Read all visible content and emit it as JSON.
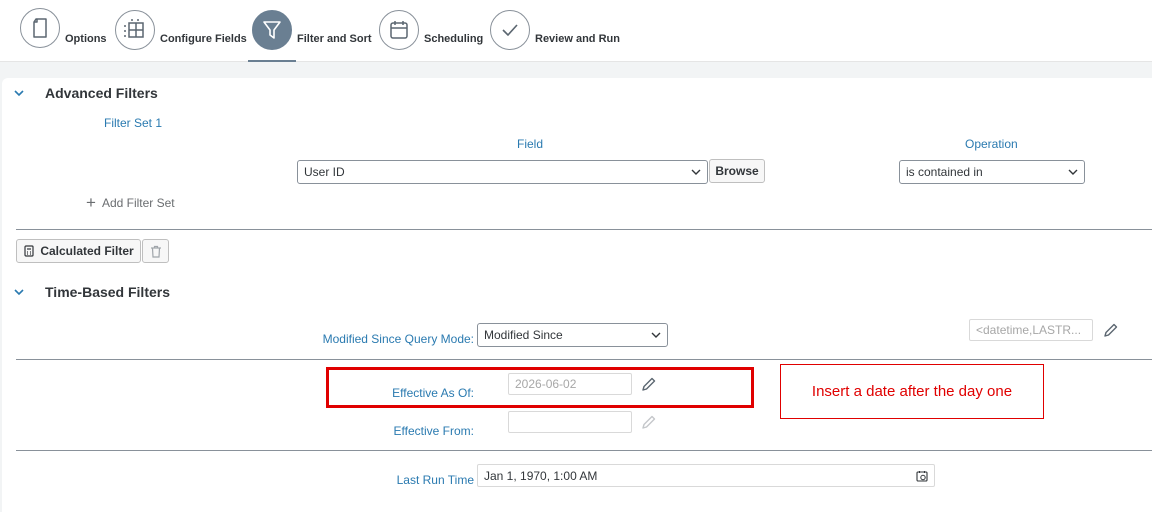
{
  "wizard": {
    "steps": [
      {
        "label": "Options",
        "icon": "document-icon"
      },
      {
        "label": "Configure Fields",
        "icon": "table-icon"
      },
      {
        "label": "Filter and Sort",
        "icon": "filter-icon",
        "active": true
      },
      {
        "label": "Scheduling",
        "icon": "calendar-icon"
      },
      {
        "label": "Review and Run",
        "icon": "checkmark-icon"
      }
    ]
  },
  "advanced_filters": {
    "title": "Advanced Filters",
    "filter_set_label": "Filter Set 1",
    "field_header": "Field",
    "operation_header": "Operation",
    "field_value": "User ID",
    "browse_label": "Browse",
    "operation_value": "is contained in",
    "add_filter_set_label": "Add Filter Set",
    "calculated_filter_label": "Calculated Filter"
  },
  "time_based_filters": {
    "title": "Time-Based Filters",
    "modified_since_label": "Modified Since Query Mode:",
    "modified_since_value": "Modified Since",
    "datetime_placeholder": "<datetime,LASTR...",
    "effective_as_of_label": "Effective As Of:",
    "effective_as_of_value": "2026-06-02",
    "effective_from_label": "Effective From:",
    "effective_from_value": "",
    "last_run_label": "Last Run Time",
    "last_run_value": "Jan 1, 1970, 1:00 AM"
  },
  "annotation": {
    "note_text": "Insert a date after the day one"
  },
  "colors": {
    "accent_blue": "#2a7ab0",
    "active_step": "#6a7f92",
    "annotation_red": "#e00000"
  }
}
